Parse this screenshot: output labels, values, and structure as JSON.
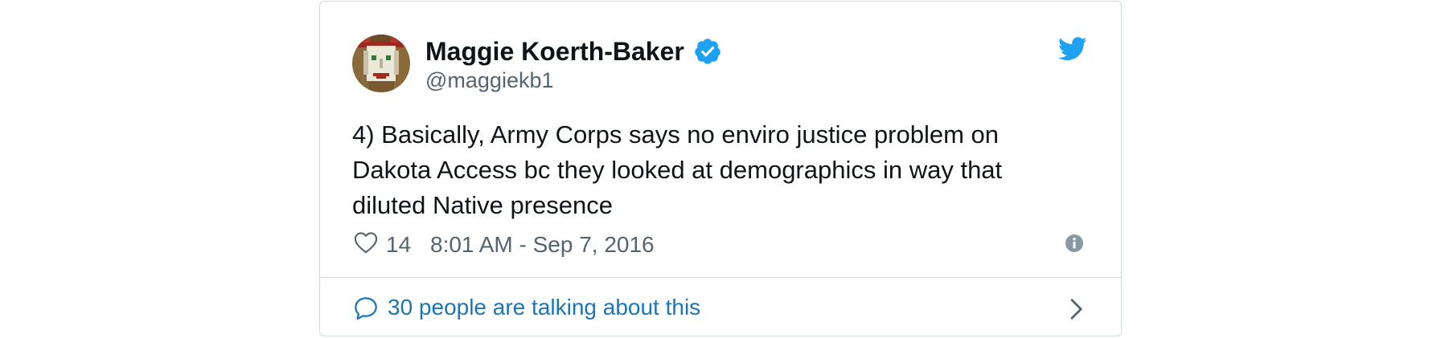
{
  "tweet": {
    "author": {
      "name": "Maggie Koerth-Baker",
      "handle": "@maggiekb1",
      "verified": true,
      "avatar_icon": "pixel-art-face-avatar"
    },
    "text": "4) Basically, Army Corps says no enviro justice problem on Dakota Access bc they looked at demographics in way that diluted Native presence",
    "likes": "14",
    "timestamp": "8:01 AM - Sep 7, 2016",
    "conversation_label": "30 people are talking about this"
  },
  "icons": {
    "brand": "twitter-bird-icon",
    "verified": "verified-badge-icon",
    "like": "heart-icon",
    "info": "info-icon",
    "reply": "speech-bubble-icon",
    "chevron": "chevron-right-icon"
  },
  "colors": {
    "twitter_blue": "#1da1f2",
    "link_blue": "#1b75bb",
    "text": "#0f1419",
    "muted": "#536471",
    "border": "#cfd9de"
  }
}
